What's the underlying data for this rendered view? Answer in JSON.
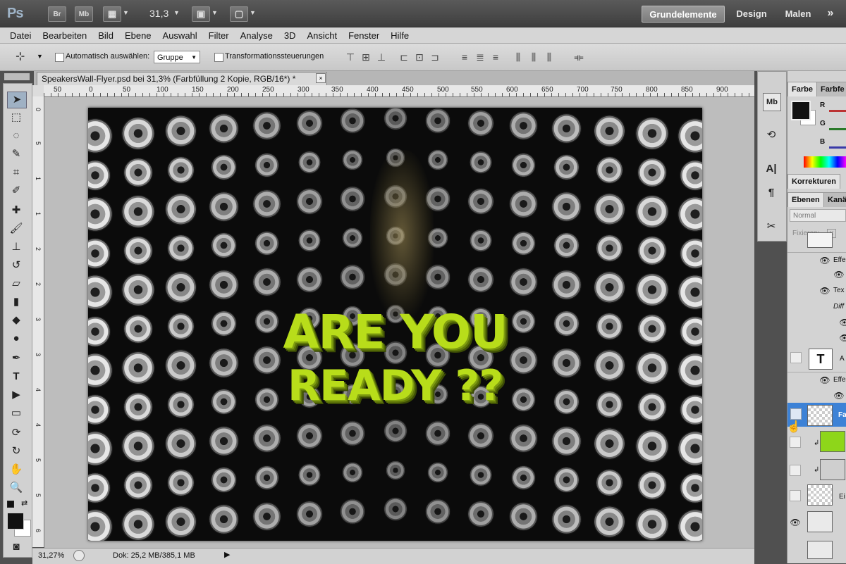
{
  "app": {
    "logo": "Ps",
    "zoom_field": "31,3"
  },
  "titlebar_buttons": {
    "bridge": "Br",
    "minibridge": "Mb"
  },
  "workspaces": {
    "active": "Grundelemente",
    "design": "Design",
    "malen": "Malen",
    "more": "»"
  },
  "menu": [
    "Datei",
    "Bearbeiten",
    "Bild",
    "Ebene",
    "Auswahl",
    "Filter",
    "Analyse",
    "3D",
    "Ansicht",
    "Fenster",
    "Hilfe"
  ],
  "options": {
    "auto_select_label": "Automatisch auswählen:",
    "auto_select_value": "Gruppe",
    "transform_label": "Transformationssteuerungen"
  },
  "document": {
    "tab_title": "SpeakersWall-Flyer.psd bei 31,3% (Farbfüllung 2 Kopie, RGB/16*) *",
    "close": "×",
    "headline_line1": "ARE YOU",
    "headline_line2": "READY ??"
  },
  "ruler_h": [
    "50",
    "0",
    "50",
    "100",
    "150",
    "200",
    "250",
    "300",
    "350",
    "400",
    "450",
    "500",
    "550",
    "600",
    "650",
    "700",
    "750",
    "800",
    "850",
    "900"
  ],
  "ruler_v": [
    "0",
    "5",
    "1",
    "1",
    "2",
    "2",
    "3",
    "3",
    "4",
    "4",
    "5",
    "5",
    "6"
  ],
  "status": {
    "zoom": "31,27%",
    "doc": "Dok: 25,2 MB/385,1 MB",
    "arrow": "▶"
  },
  "panels": {
    "color_tab": "Farbe",
    "swatch_tab": "Farbfe",
    "channels": [
      "R",
      "G",
      "B"
    ],
    "korrekturen_tab": "Korrekturen",
    "ebenen_tab": "Ebenen",
    "kanaele_tab": "Kanä",
    "blend_mode": "Normal",
    "fixieren": "Fixieren:",
    "layers": [
      {
        "label": "Effe"
      },
      {
        "label": "Tex"
      },
      {
        "label": "Diff"
      },
      {
        "label": "A"
      },
      {
        "label": "Effe"
      },
      {
        "label": "Fa"
      },
      {
        "label": ""
      },
      {
        "label": ""
      },
      {
        "label": "Ei"
      },
      {
        "label": ""
      }
    ]
  },
  "colors": {
    "accent": "#b8dd1a",
    "chrome": "#3e3e3e",
    "panel": "#d3d3d3"
  },
  "icons": [
    "move-tool-icon",
    "marquee-icon",
    "lasso-icon",
    "quick-select-icon",
    "crop-icon",
    "eyedropper-icon",
    "healing-icon",
    "brush-icon",
    "stamp-icon",
    "history-brush-icon",
    "eraser-icon",
    "gradient-icon",
    "blur-icon",
    "dodge-icon",
    "pen-icon",
    "type-icon",
    "path-select-icon",
    "shape-icon",
    "3d-rotate-icon",
    "3d-orbit-icon",
    "hand-icon",
    "zoom-icon"
  ]
}
